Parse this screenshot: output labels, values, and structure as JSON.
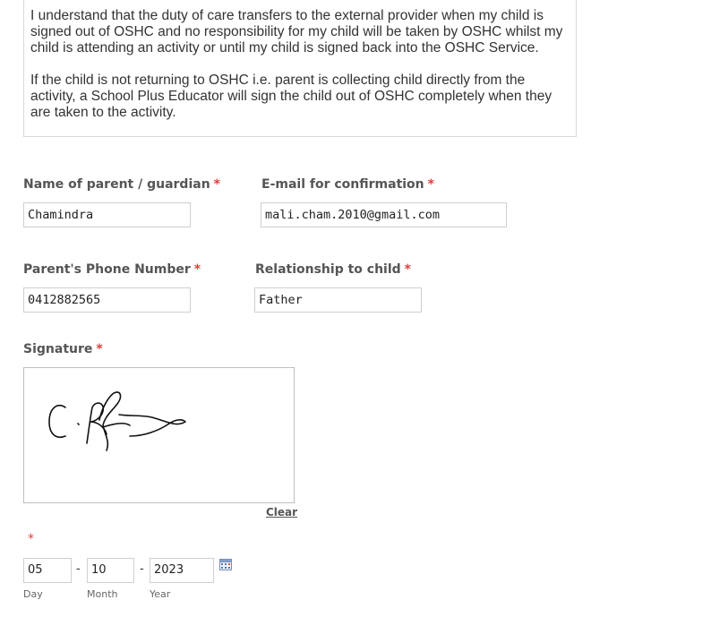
{
  "terms": {
    "paragraph1": "I understand that the duty of care transfers to the external provider when my child is signed out of OSHC and no responsibility for my child will be taken by OSHC whilst my child is attending an activity or until my child is signed back into the OSHC Service.",
    "paragraph2": "If the child is not returning to OSHC i.e. parent is collecting child directly from the activity, a School Plus Educator will sign the child out of OSHC completely when they are taken to the activity."
  },
  "required_marker": "*",
  "fields": {
    "parent_name": {
      "label": "Name of parent / guardian",
      "value": "Chamindra"
    },
    "email": {
      "label": "E-mail for confirmation",
      "value": "mali.cham.2010@gmail.com"
    },
    "phone": {
      "label": "Parent's Phone Number",
      "value": "0412882565"
    },
    "relationship": {
      "label": "Relationship to child",
      "value": "Father"
    }
  },
  "signature": {
    "label": "Signature",
    "clear_label": "Clear"
  },
  "date": {
    "separator": "-",
    "day": {
      "value": "05",
      "label": "Day"
    },
    "month": {
      "value": "10",
      "label": "Month"
    },
    "year": {
      "value": "2023",
      "label": "Year"
    }
  },
  "icons": {
    "calendar": "calendar-icon"
  },
  "colors": {
    "required": "#e33b3b",
    "label": "#555555",
    "border": "#cfcfcf"
  }
}
